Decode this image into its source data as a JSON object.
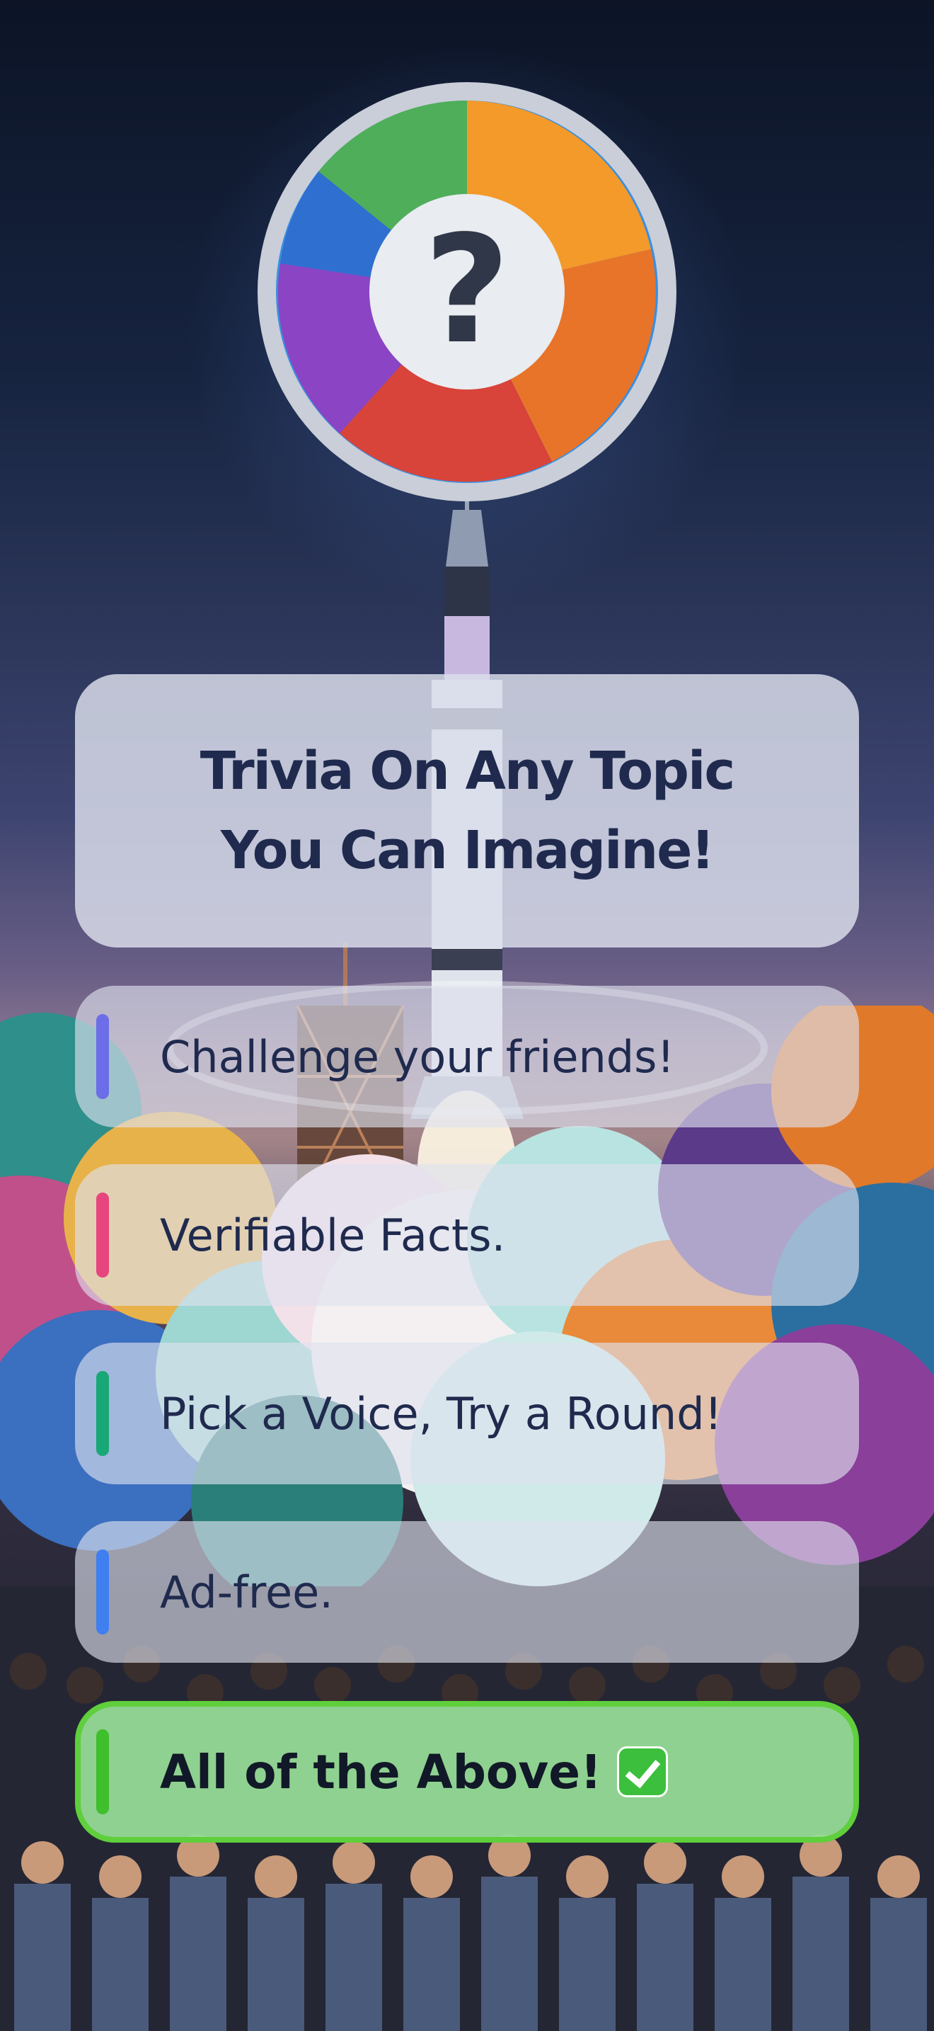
{
  "title": {
    "line1": "Trivia On Any Topic",
    "line2": "You Can Imagine!"
  },
  "logo": {
    "icon": "question-mark-icon",
    "glyph": "?"
  },
  "options": [
    {
      "label": "Challenge your friends!",
      "accent": "#6b6ee8"
    },
    {
      "label": "Verifiable Facts.",
      "accent": "#e6457d"
    },
    {
      "label": "Pick a Voice, Try a Round!",
      "accent": "#18a876"
    },
    {
      "label": "Ad-free.",
      "accent": "#3f7ff0"
    },
    {
      "label": "All of the Above!",
      "accent": "#3fbf2b",
      "badge_icon": "check-mark-icon",
      "selected": true
    }
  ],
  "colors": {
    "title_text": "#1f2a4e",
    "selected_border": "#5fcf3c",
    "selected_fill": "#96da96"
  }
}
